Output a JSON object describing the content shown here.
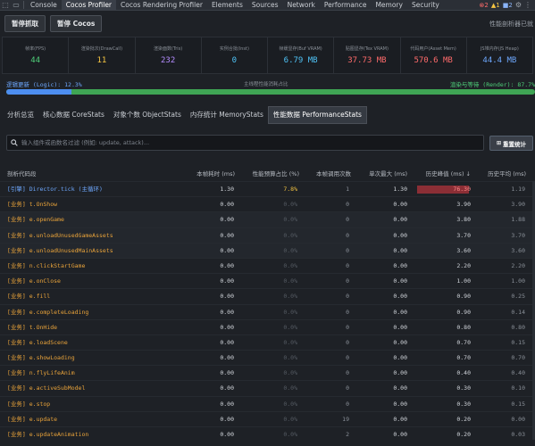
{
  "devtools": {
    "tabs": [
      "Console",
      "Cocos Profiler",
      "Cocos Rendering Profiler",
      "Elements",
      "Sources",
      "Network",
      "Performance",
      "Memory",
      "Security"
    ],
    "active_tab": "Cocos Profiler",
    "errors": "2",
    "warnings": "1",
    "info": "2"
  },
  "toolbar": {
    "pause_capture": "暂停抓取",
    "pause_cocos": "暂停 Cocos",
    "status": "性能剖析器已就"
  },
  "stats": [
    {
      "label": "帧率(FPS)",
      "value": "44",
      "color": "#4fd07a"
    },
    {
      "label": "渲染批次(DrawCall)",
      "value": "11",
      "color": "#f5c542"
    },
    {
      "label": "渲染面数(Tris)",
      "value": "232",
      "color": "#b48cff"
    },
    {
      "label": "实例合批(Inst)",
      "value": "0",
      "color": "#4fc3f7"
    },
    {
      "label": "帧缓显存(Buf VRAM)",
      "value": "6.79 MB",
      "color": "#4fc3f7"
    },
    {
      "label": "贴图显存(Tex VRAM)",
      "value": "37.73 MB",
      "color": "#ff6b6b"
    },
    {
      "label": "代码用户(Asset Mem)",
      "value": "570.6 MB",
      "color": "#ff6b6b"
    },
    {
      "label": "JS堆内存(JS Heap)",
      "value": "44.4 MB",
      "color": "#6ea8fe"
    }
  ],
  "logic_render": {
    "logic_label": "逻辑更新 (Logic): 12.3%",
    "middle_label": "主线程性能消耗占比",
    "render_label": "渲染与等待 (Render): 87.7%",
    "logic_fraction": 0.123
  },
  "tabs": [
    {
      "label": "分析总览",
      "active": false
    },
    {
      "label": "核心数据 CoreStats",
      "active": false
    },
    {
      "label": "对象个数 ObjectStats",
      "active": false
    },
    {
      "label": "内存统计 MemoryStats",
      "active": false
    },
    {
      "label": "性能数据 PerformanceStats",
      "active": true
    }
  ],
  "search": {
    "placeholder": "输入组件或函数名过滤 (例如: update, attack)...",
    "value": ""
  },
  "reset_button": "重置统计",
  "table": {
    "headers": {
      "name": "剖析代码段",
      "self": "本帧耗时 (ms)",
      "pct": "性能预算占比 (%)",
      "calls": "本帧调用次数",
      "max": "单次最大 (ms)",
      "hist": "历史峰值 (ms) ↓",
      "avg": "历史平均 (ms)"
    },
    "rows": [
      {
        "name": "[引擎] Director.tick (主循环)",
        "engine": true,
        "self": "1.30",
        "pct": "7.8%",
        "calls": "1",
        "max": "1.30",
        "hist": "76.30",
        "avg": "1.19"
      },
      {
        "name": "[业务] t.OnShow",
        "self": "0.00",
        "pct": "0.0%",
        "calls": "0",
        "max": "0.00",
        "hist": "3.90",
        "avg": "3.90"
      },
      {
        "name": "[业务] e.openGame",
        "self": "0.00",
        "pct": "0.0%",
        "calls": "0",
        "max": "0.00",
        "hist": "3.80",
        "avg": "1.88"
      },
      {
        "name": "[业务] e.unloadUnusedGameAssets",
        "self": "0.00",
        "pct": "0.0%",
        "calls": "0",
        "max": "0.00",
        "hist": "3.70",
        "avg": "3.70"
      },
      {
        "name": "[业务] e.unloadUnusedMainAssets",
        "self": "0.00",
        "pct": "0.0%",
        "calls": "0",
        "max": "0.00",
        "hist": "3.60",
        "avg": "3.60"
      },
      {
        "name": "[业务] n.clickStartGame",
        "self": "0.00",
        "pct": "0.0%",
        "calls": "0",
        "max": "0.00",
        "hist": "2.20",
        "avg": "2.20"
      },
      {
        "name": "[业务] e.onClose",
        "self": "0.00",
        "pct": "0.0%",
        "calls": "0",
        "max": "0.00",
        "hist": "1.00",
        "avg": "1.00"
      },
      {
        "name": "[业务] e.fill",
        "self": "0.00",
        "pct": "0.0%",
        "calls": "0",
        "max": "0.00",
        "hist": "0.90",
        "avg": "0.25"
      },
      {
        "name": "[业务] e.completeLoading",
        "self": "0.00",
        "pct": "0.0%",
        "calls": "0",
        "max": "0.00",
        "hist": "0.90",
        "avg": "0.14"
      },
      {
        "name": "[业务] t.OnHide",
        "self": "0.00",
        "pct": "0.0%",
        "calls": "0",
        "max": "0.00",
        "hist": "0.80",
        "avg": "0.80"
      },
      {
        "name": "[业务] e.loadScene",
        "self": "0.00",
        "pct": "0.0%",
        "calls": "0",
        "max": "0.00",
        "hist": "0.70",
        "avg": "0.15"
      },
      {
        "name": "[业务] e.showLoading",
        "self": "0.00",
        "pct": "0.0%",
        "calls": "0",
        "max": "0.00",
        "hist": "0.70",
        "avg": "0.70"
      },
      {
        "name": "[业务] n.flyLifeAnim",
        "self": "0.00",
        "pct": "0.0%",
        "calls": "0",
        "max": "0.00",
        "hist": "0.40",
        "avg": "0.40"
      },
      {
        "name": "[业务] e.activeSubModel",
        "self": "0.00",
        "pct": "0.0%",
        "calls": "0",
        "max": "0.00",
        "hist": "0.30",
        "avg": "0.10"
      },
      {
        "name": "[业务] e.stop",
        "self": "0.00",
        "pct": "0.0%",
        "calls": "0",
        "max": "0.00",
        "hist": "0.30",
        "avg": "0.15"
      },
      {
        "name": "[业务] e.update",
        "self": "0.00",
        "pct": "0.0%",
        "calls": "19",
        "max": "0.00",
        "hist": "0.20",
        "avg": "0.00"
      },
      {
        "name": "[业务] e.updateAnimation",
        "self": "0.00",
        "pct": "0.0%",
        "calls": "2",
        "max": "0.00",
        "hist": "0.20",
        "avg": "0.03"
      }
    ]
  }
}
